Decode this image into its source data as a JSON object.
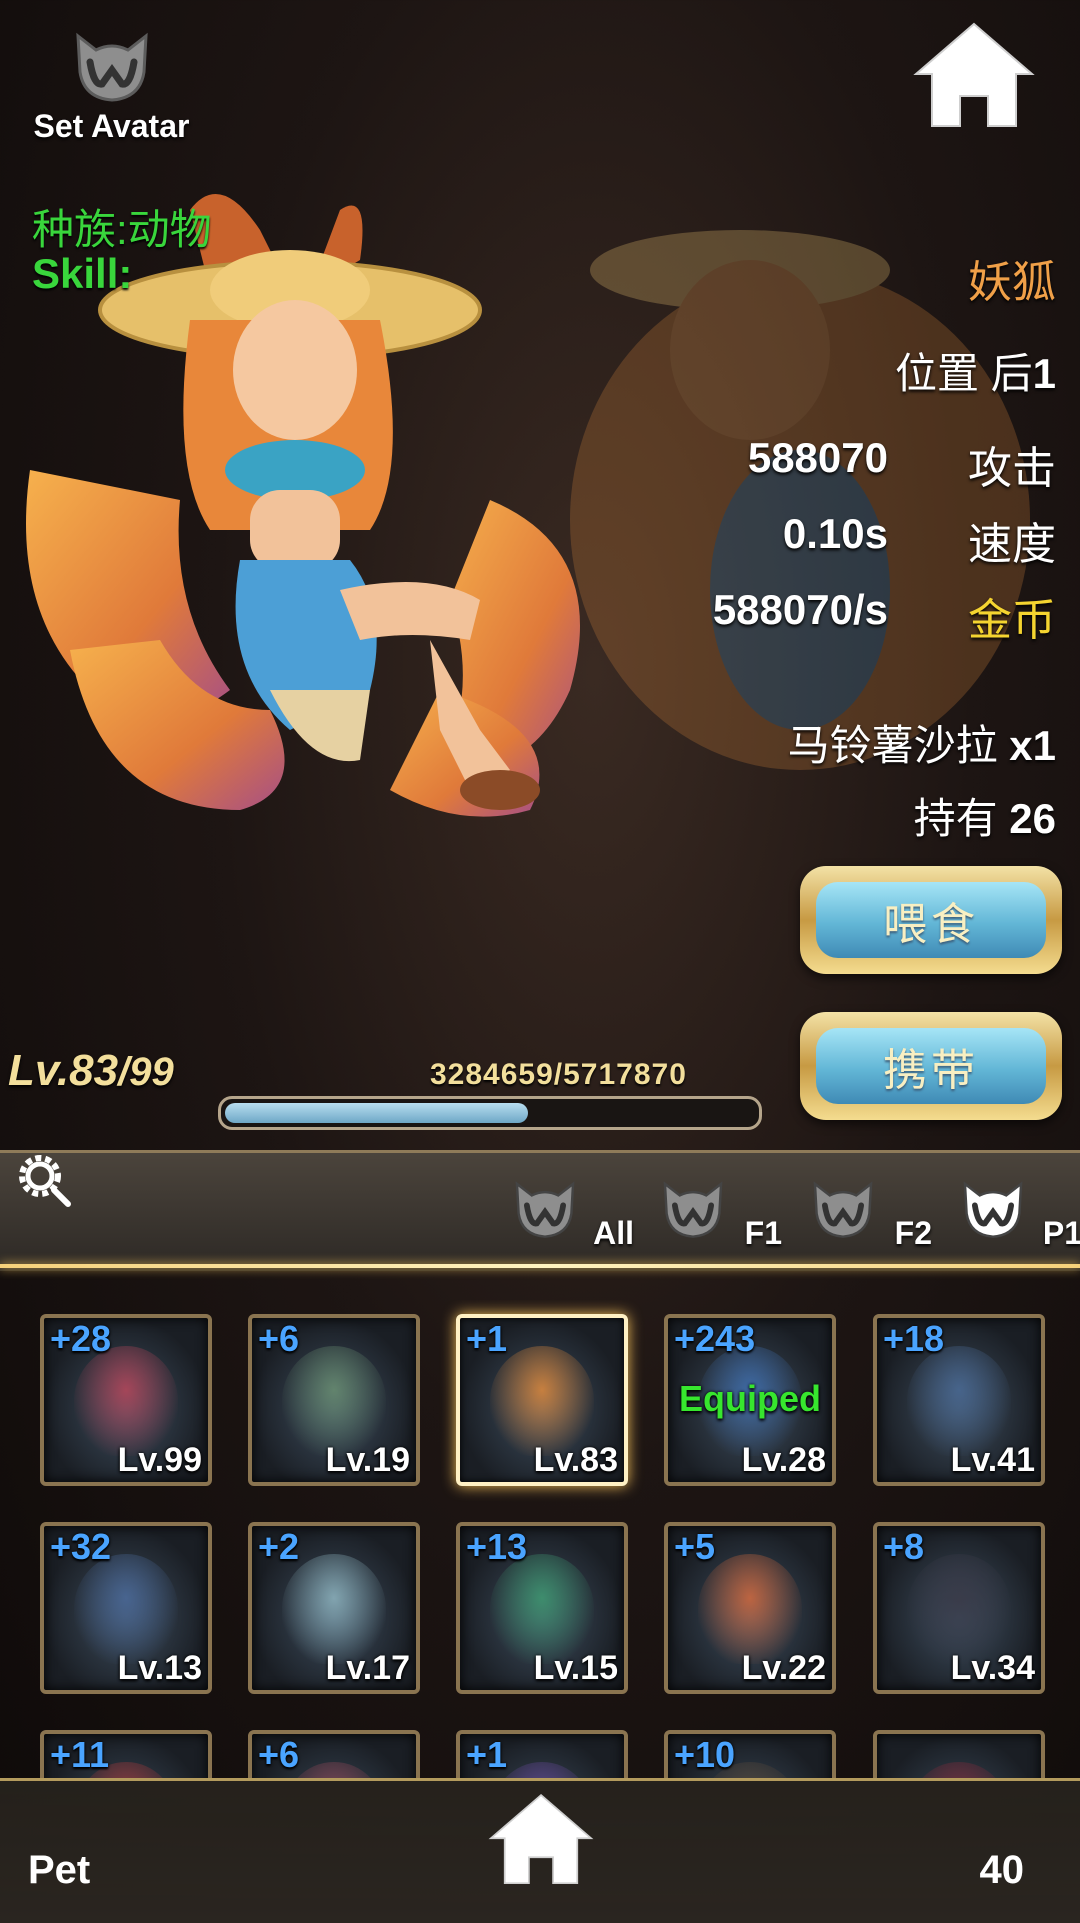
{
  "header": {
    "avatar_label": "Set Avatar",
    "home_icon": "home-icon"
  },
  "pet": {
    "race": "种族:动物",
    "skill": "Skill:",
    "name": "妖狐",
    "position_label": "位置 后",
    "position_value": "1",
    "attack_value": "588070",
    "attack_label": "攻击",
    "speed_value": "0.10s",
    "speed_label": "速度",
    "gold_value": "588070/s",
    "gold_label": "金币",
    "food_name": "马铃薯沙拉",
    "food_qty": "x1",
    "owned_label": "持有",
    "owned_value": "26",
    "level": "Lv.83",
    "level_max": "/99",
    "exp_text": "3284659/5717870",
    "exp_fraction": 0.5745
  },
  "buttons": {
    "feed": "喂食",
    "carry": "携带"
  },
  "tabs": [
    {
      "label": "All",
      "active": false
    },
    {
      "label": "F1",
      "active": false
    },
    {
      "label": "F2",
      "active": false
    },
    {
      "label": "P1",
      "active": true
    }
  ],
  "pets": [
    {
      "plus": "+28",
      "level": "Lv.99",
      "equipped": false,
      "selected": false,
      "color": "#b8465a"
    },
    {
      "plus": "+6",
      "level": "Lv.19",
      "equipped": false,
      "selected": false,
      "color": "#6a8f72"
    },
    {
      "plus": "+1",
      "level": "Lv.83",
      "equipped": false,
      "selected": true,
      "color": "#e08a3c"
    },
    {
      "plus": "+243",
      "level": "Lv.28",
      "equipped": true,
      "selected": false,
      "color": "#3f6fb0"
    },
    {
      "plus": "+18",
      "level": "Lv.41",
      "equipped": false,
      "selected": false,
      "color": "#4a6a95"
    },
    {
      "plus": "+32",
      "level": "Lv.13",
      "equipped": false,
      "selected": false,
      "color": "#4b6a9a"
    },
    {
      "plus": "+2",
      "level": "Lv.17",
      "equipped": false,
      "selected": false,
      "color": "#8fb5c0"
    },
    {
      "plus": "+13",
      "level": "Lv.15",
      "equipped": false,
      "selected": false,
      "color": "#3f9a72"
    },
    {
      "plus": "+5",
      "level": "Lv.22",
      "equipped": false,
      "selected": false,
      "color": "#d46a3e"
    },
    {
      "plus": "+8",
      "level": "Lv.34",
      "equipped": false,
      "selected": false,
      "color": "#3a3a48"
    },
    {
      "plus": "+11",
      "level": "",
      "equipped": false,
      "selected": false,
      "color": "#b33a3a"
    },
    {
      "plus": "+6",
      "level": "",
      "equipped": false,
      "selected": false,
      "color": "#9a4a5a"
    },
    {
      "plus": "+1",
      "level": "",
      "equipped": false,
      "selected": false,
      "color": "#6a4aa0"
    },
    {
      "plus": "+10",
      "level": "",
      "equipped": false,
      "selected": false,
      "color": "#5a4a3a"
    },
    {
      "plus": "",
      "level": "",
      "equipped": false,
      "selected": false,
      "color": "#8a2a3a"
    }
  ],
  "equipped_label": "Equiped",
  "footer": {
    "title": "Pet",
    "count": "40"
  }
}
